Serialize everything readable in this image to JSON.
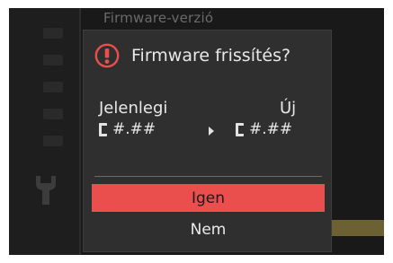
{
  "background": {
    "menu_title": "Firmware-verzió"
  },
  "dialog": {
    "title": "Firmware frissítés?",
    "current_label": "Jelenlegi",
    "new_label": "Új",
    "current_version": "#.##",
    "new_version": "#.##",
    "options": [
      {
        "label": "Igen",
        "selected": true
      },
      {
        "label": "Nem",
        "selected": false
      }
    ]
  },
  "colors": {
    "accent": "#ea4e4d",
    "dialog_bg": "#2f2f2f",
    "screen_bg": "#191919"
  },
  "icons": {
    "warning": "warning-circle-icon",
    "arrow": "arrow-right-icon",
    "setup": "wrench-icon"
  }
}
